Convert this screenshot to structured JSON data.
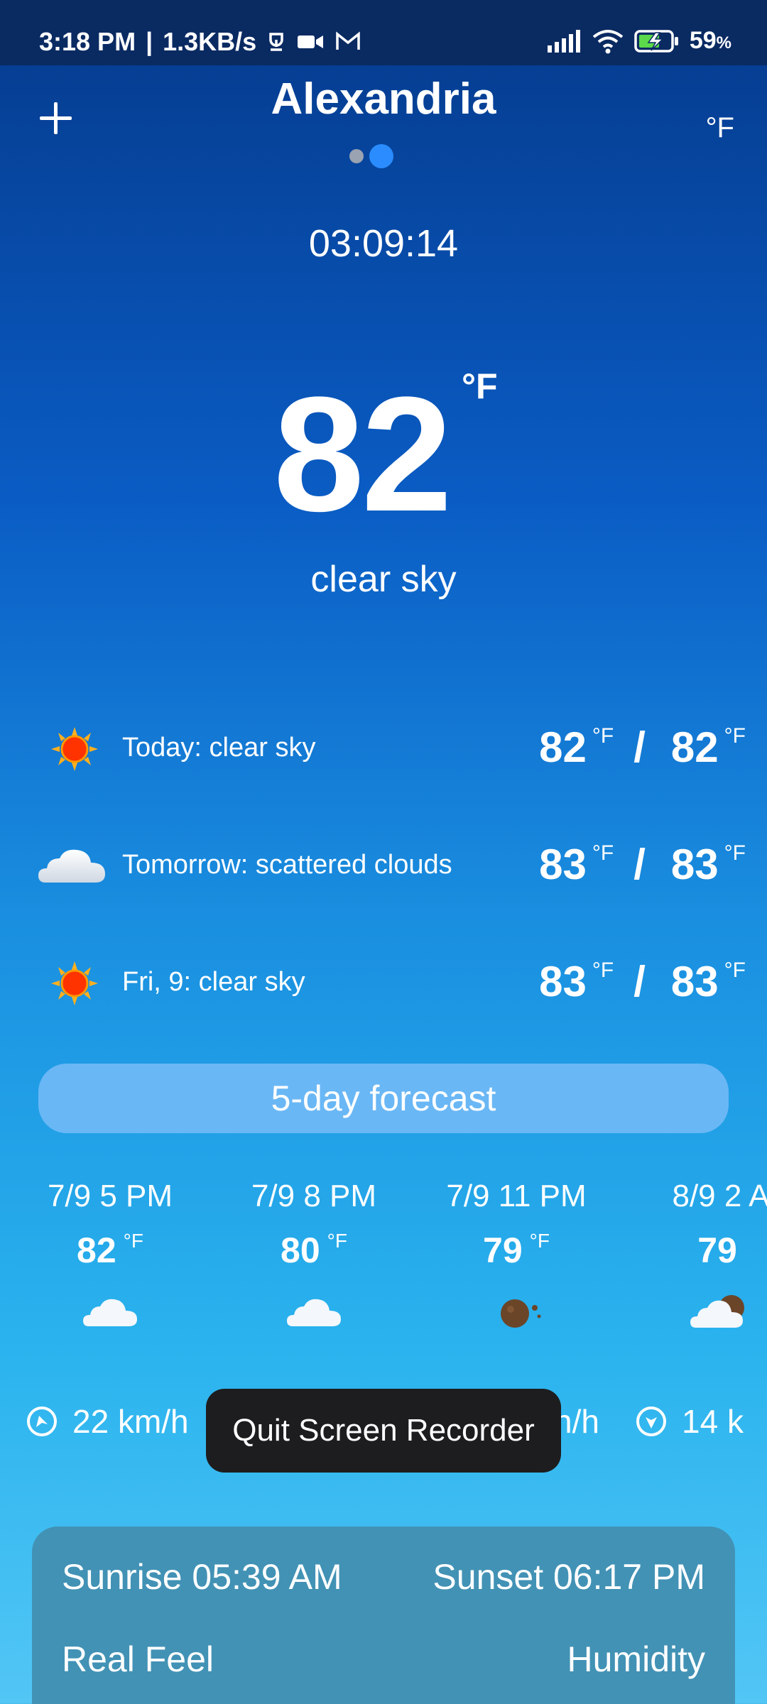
{
  "status_bar": {
    "time": "3:18 PM",
    "separator": "|",
    "speed": "1.3KB/s",
    "battery": "59",
    "battery_unit": "%"
  },
  "header": {
    "city": "Alexandria",
    "unit_toggle": "°F"
  },
  "current": {
    "clock": "03:09:14",
    "temperature": "82",
    "unit": "°F",
    "condition": "clear sky"
  },
  "daily": [
    {
      "label": "Today: clear sky",
      "icon": "sun-icon",
      "high": "82",
      "low": "82",
      "unit": "°F",
      "sep": "/"
    },
    {
      "label": "Tomorrow: scattered clouds",
      "icon": "cloud-icon",
      "high": "83",
      "low": "83",
      "unit": "°F",
      "sep": "/"
    },
    {
      "label": "Fri, 9: clear sky",
      "icon": "sun-icon",
      "high": "83",
      "low": "83",
      "unit": "°F",
      "sep": "/"
    }
  ],
  "forecast_button": "5-day forecast",
  "hourly": [
    {
      "time": "7/9 5 PM",
      "temp": "82",
      "unit": "°F",
      "icon": "cloud-icon"
    },
    {
      "time": "7/9 8 PM",
      "temp": "80",
      "unit": "°F",
      "icon": "cloud-icon"
    },
    {
      "time": "7/9 11 PM",
      "temp": "79",
      "unit": "°F",
      "icon": "moon-icon"
    },
    {
      "time": "8/9 2 A",
      "temp": "79",
      "unit": "",
      "icon": "cloud-moon-icon"
    }
  ],
  "wind": [
    {
      "speed": "22 km/h"
    },
    {
      "speed": "n/h"
    },
    {
      "speed": "14 k"
    }
  ],
  "toast": "Quit Screen Recorder",
  "details": {
    "sunrise": "Sunrise 05:39 AM",
    "sunset": "Sunset 06:17 PM",
    "real_feel_label": "Real Feel",
    "humidity_label": "Humidity"
  }
}
